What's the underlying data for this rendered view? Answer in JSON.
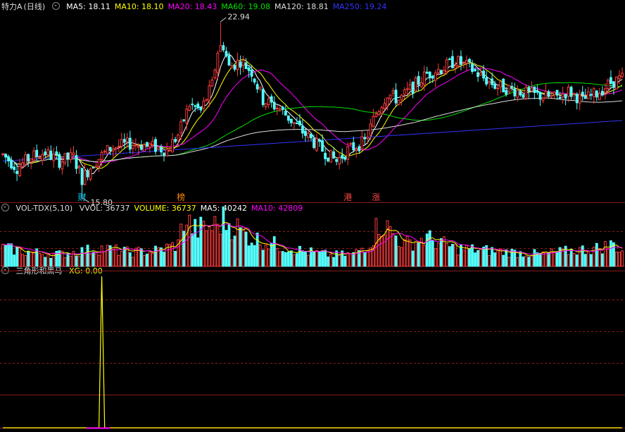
{
  "header": {
    "title": "特力A",
    "period": "(日线)",
    "ma": [
      {
        "label": "MA5: 18.11",
        "color": "#ffffff"
      },
      {
        "label": "MA10: 18.10",
        "color": "#ffff00"
      },
      {
        "label": "MA20: 18.43",
        "color": "#ff00ff"
      },
      {
        "label": "MA60: 19.08",
        "color": "#00e000"
      },
      {
        "label": "MA120: 18.81",
        "color": "#dddddd"
      },
      {
        "label": "MA250: 19.24",
        "color": "#3333ff"
      }
    ]
  },
  "volume_header": {
    "title": "VOL-TDX(5,10)",
    "items": [
      {
        "label": "VVOL: 36737",
        "color": "#dddddd"
      },
      {
        "label": "VOLUME: 36737",
        "color": "#ffff00"
      },
      {
        "label": "MA5: 40242",
        "color": "#ffffff"
      },
      {
        "label": "MA10: 42809",
        "color": "#ff00ff"
      }
    ]
  },
  "indicator_header": {
    "title": "三角形和黑马",
    "items": [
      {
        "label": "XG: 0.00",
        "color": "#ffff00"
      }
    ]
  },
  "annotations": {
    "high_label": "22.94",
    "low_label": "15.80",
    "event_markers": [
      {
        "text": "财",
        "color": "#00ccff",
        "bar": 27
      },
      {
        "text": "榜",
        "color": "#ff8800",
        "bar": 62
      },
      {
        "text": "港",
        "color": "#ff4444",
        "bar": 121
      },
      {
        "text": "涨",
        "color": "#ff4444",
        "bar": 131
      }
    ]
  },
  "colors": {
    "up": "#ff3c3c",
    "down": "#54ffff",
    "grid": "#8b1a1a",
    "ma5": "#ffffff",
    "ma10": "#ffff00",
    "ma20": "#ff00ff",
    "ma60": "#00e000",
    "ma120": "#dddddd",
    "ma250": "#3333ff"
  },
  "chart_data": [
    {
      "type": "candlestick",
      "name": "price",
      "count": 220,
      "ylim": [
        15.3,
        23.5
      ],
      "anchors": [
        [
          0,
          17.0
        ],
        [
          5,
          16.4
        ],
        [
          10,
          16.9
        ],
        [
          15,
          17.1
        ],
        [
          20,
          16.7
        ],
        [
          25,
          16.9
        ],
        [
          28,
          15.9
        ],
        [
          32,
          16.6
        ],
        [
          38,
          17.3
        ],
        [
          45,
          17.5
        ],
        [
          52,
          17.4
        ],
        [
          58,
          17.2
        ],
        [
          62,
          17.9
        ],
        [
          66,
          19.3
        ],
        [
          70,
          19.0
        ],
        [
          74,
          20.2
        ],
        [
          77,
          22.5
        ],
        [
          80,
          21.0
        ],
        [
          84,
          21.3
        ],
        [
          88,
          20.8
        ],
        [
          92,
          19.5
        ],
        [
          98,
          19.1
        ],
        [
          104,
          18.3
        ],
        [
          108,
          17.8
        ],
        [
          114,
          17.1
        ],
        [
          118,
          16.7
        ],
        [
          122,
          17.2
        ],
        [
          128,
          17.6
        ],
        [
          132,
          18.9
        ],
        [
          136,
          19.8
        ],
        [
          140,
          19.5
        ],
        [
          145,
          20.1
        ],
        [
          150,
          20.7
        ],
        [
          156,
          21.0
        ],
        [
          160,
          21.3
        ],
        [
          165,
          21.0
        ],
        [
          170,
          20.5
        ],
        [
          175,
          20.1
        ],
        [
          180,
          20.0
        ],
        [
          185,
          19.8
        ],
        [
          190,
          19.7
        ],
        [
          195,
          19.6
        ],
        [
          200,
          19.9
        ],
        [
          205,
          19.5
        ],
        [
          210,
          19.8
        ],
        [
          215,
          20.3
        ],
        [
          219,
          20.5
        ]
      ],
      "high_label_bar": 77,
      "low_label_bar": 28
    },
    {
      "type": "bar",
      "name": "volume",
      "ylim": [
        0,
        130000
      ],
      "anchors": [
        [
          0,
          45000
        ],
        [
          10,
          35000
        ],
        [
          20,
          30000
        ],
        [
          35,
          45000
        ],
        [
          45,
          35000
        ],
        [
          55,
          40000
        ],
        [
          62,
          55000
        ],
        [
          64,
          120000
        ],
        [
          68,
          90000
        ],
        [
          75,
          100000
        ],
        [
          78,
          115000
        ],
        [
          82,
          100000
        ],
        [
          88,
          70000
        ],
        [
          96,
          55000
        ],
        [
          106,
          38000
        ],
        [
          116,
          28000
        ],
        [
          124,
          30000
        ],
        [
          130,
          60000
        ],
        [
          133,
          110000
        ],
        [
          136,
          95000
        ],
        [
          142,
          55000
        ],
        [
          150,
          70000
        ],
        [
          160,
          45000
        ],
        [
          170,
          40000
        ],
        [
          180,
          35000
        ],
        [
          190,
          30000
        ],
        [
          200,
          38000
        ],
        [
          210,
          45000
        ],
        [
          216,
          55000
        ],
        [
          219,
          36737
        ]
      ]
    },
    {
      "type": "line",
      "name": "XG",
      "ylim": [
        0,
        1
      ],
      "spike_bar": 35,
      "values_note": "0 everywhere except a single 1 at spike_bar"
    }
  ]
}
